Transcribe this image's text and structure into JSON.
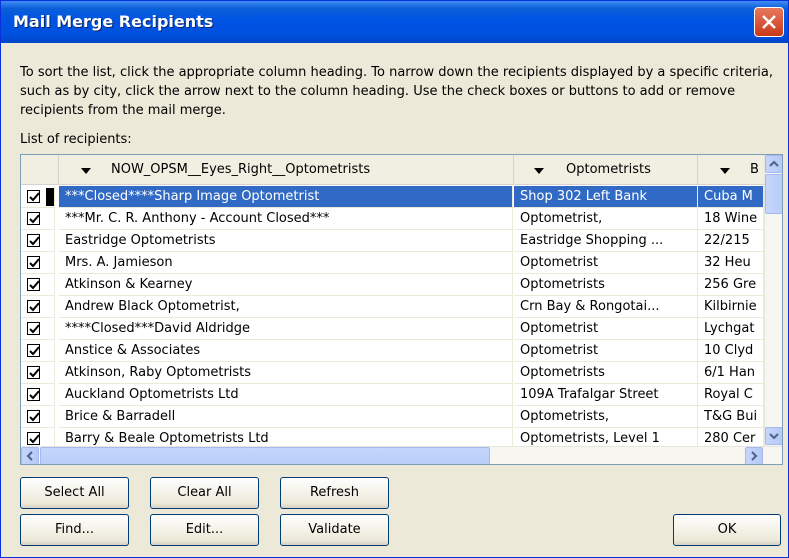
{
  "window": {
    "title": "Mail Merge Recipients",
    "close_icon": "close-icon"
  },
  "instructions": "To sort the list, click the appropriate column heading.  To narrow down the recipients displayed by a specific criteria, such as by city, click the arrow next to the column heading.  Use the check boxes or buttons to add or remove recipients from the mail merge.",
  "list_label": "List of recipients:",
  "columns": [
    {
      "label": "NOW_OPSM__Eyes_Right__Optometrists"
    },
    {
      "label": "Optometrists"
    },
    {
      "label": "B"
    }
  ],
  "rows": [
    {
      "checked": true,
      "selected": true,
      "name": "***Closed****Sharp Image Optometrist",
      "opt": "Shop 302 Left Bank",
      "b": "Cuba M"
    },
    {
      "checked": true,
      "selected": false,
      "name": "***Mr. C. R. Anthony - Account Closed***",
      "opt": "Optometrist,",
      "b": "18 Wine"
    },
    {
      "checked": true,
      "selected": false,
      "name": "Eastridge Optometrists",
      "opt": "Eastridge Shopping ...",
      "b": "22/215"
    },
    {
      "checked": true,
      "selected": false,
      "name": "Mrs. A. Jamieson",
      "opt": "Optometrist",
      "b": "32 Heu"
    },
    {
      "checked": true,
      "selected": false,
      "name": "Atkinson & Kearney",
      "opt": "Optometrists",
      "b": "256 Gre"
    },
    {
      "checked": true,
      "selected": false,
      "name": "Andrew Black Optometrist,",
      "opt": "Crn Bay & Rongotai...",
      "b": "Kilbirnie"
    },
    {
      "checked": true,
      "selected": false,
      "name": "****Closed***David Aldridge",
      "opt": "Optometrist",
      "b": "Lychgat"
    },
    {
      "checked": true,
      "selected": false,
      "name": "Anstice & Associates",
      "opt": "Optometrist",
      "b": "10 Clyd"
    },
    {
      "checked": true,
      "selected": false,
      "name": "Atkinson, Raby Optometrists",
      "opt": "Optometrists",
      "b": "6/1 Han"
    },
    {
      "checked": true,
      "selected": false,
      "name": "Auckland Optometrists Ltd",
      "opt": "109A Trafalgar Street",
      "b": "Royal C"
    },
    {
      "checked": true,
      "selected": false,
      "name": "Brice & Barradell",
      "opt": "Optometrists,",
      "b": "T&G Bui"
    },
    {
      "checked": true,
      "selected": false,
      "name": "Barry & Beale Optometrists Ltd",
      "opt": "Optometrists, Level 1",
      "b": "280 Cer"
    }
  ],
  "buttons": {
    "select_all": "Select All",
    "clear_all": "Clear All",
    "refresh": "Refresh",
    "find": "Find...",
    "edit": "Edit...",
    "validate": "Validate",
    "ok": "OK"
  },
  "colors": {
    "titlebar": "#0054e3",
    "dialog_bg": "#ece9d8",
    "selection": "#316ac5"
  }
}
